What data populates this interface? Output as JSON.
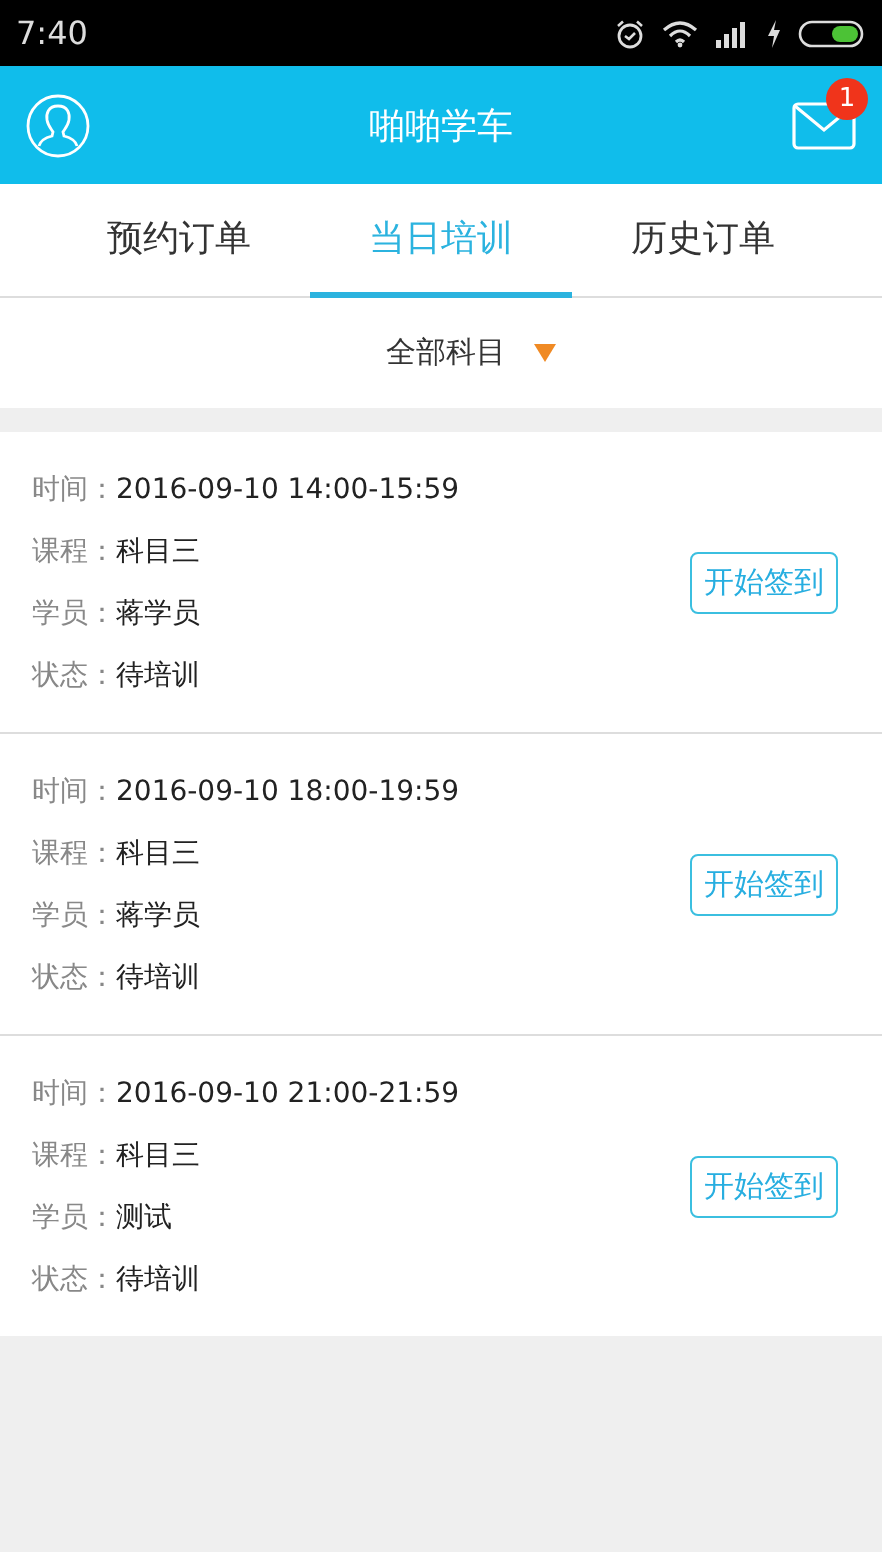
{
  "status_bar": {
    "time": "7:40"
  },
  "header": {
    "title": "啪啪学车",
    "unread": "1"
  },
  "tabs": [
    {
      "label": "预约订单",
      "selected": false
    },
    {
      "label": "当日培训",
      "selected": true
    },
    {
      "label": "历史订单",
      "selected": false
    }
  ],
  "filter": {
    "label": "全部科目"
  },
  "orders": [
    {
      "fields": [
        {
          "label": "时间：",
          "value": "2016-09-10 14:00-15:59"
        },
        {
          "label": "课程：",
          "value": "科目三"
        },
        {
          "label": "学员：",
          "value": "蒋学员"
        },
        {
          "label": "状态：",
          "value": "待培训"
        }
      ],
      "action": "开始签到"
    },
    {
      "fields": [
        {
          "label": "时间：",
          "value": "2016-09-10 18:00-19:59"
        },
        {
          "label": "课程：",
          "value": "科目三"
        },
        {
          "label": "学员：",
          "value": "蒋学员"
        },
        {
          "label": "状态：",
          "value": "待培训"
        }
      ],
      "action": "开始签到"
    },
    {
      "fields": [
        {
          "label": "时间：",
          "value": "2016-09-10 21:00-21:59"
        },
        {
          "label": "课程：",
          "value": "科目三"
        },
        {
          "label": "学员：",
          "value": "测试"
        },
        {
          "label": "状态：",
          "value": "待培训"
        }
      ],
      "action": "开始签到"
    }
  ]
}
